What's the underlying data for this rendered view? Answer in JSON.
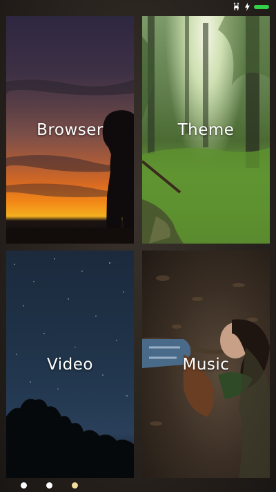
{
  "status_bar": {
    "icons": [
      "deer-icon",
      "charging-bolt-icon",
      "battery-icon"
    ],
    "battery_color": "#34d04a"
  },
  "tiles": [
    {
      "id": "browser",
      "label": "Browser"
    },
    {
      "id": "theme",
      "label": "Theme"
    },
    {
      "id": "video",
      "label": "Video"
    },
    {
      "id": "music",
      "label": "Music"
    }
  ],
  "pager": {
    "page_count": 3,
    "active_page": 3,
    "active_color": "#f2dc9a",
    "inactive_color": "#ffffff"
  }
}
